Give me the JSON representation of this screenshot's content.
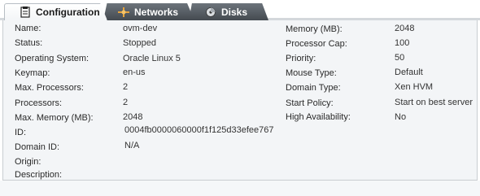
{
  "tabs": [
    {
      "label": "Configuration",
      "icon": "document-icon"
    },
    {
      "label": "Networks",
      "icon": "network-icon"
    },
    {
      "label": "Disks",
      "icon": "disk-icon"
    }
  ],
  "left_fields": [
    {
      "label": "Name:",
      "value": "ovm-dev"
    },
    {
      "label": "Status:",
      "value": "Stopped"
    },
    {
      "label": "Operating System:",
      "value": "Oracle Linux 5"
    },
    {
      "label": "Keymap:",
      "value": "en-us"
    },
    {
      "label": "Max. Processors:",
      "value": "2"
    },
    {
      "label": "Processors:",
      "value": "2"
    },
    {
      "label": "Max. Memory (MB):",
      "value": "2048"
    },
    {
      "label": "ID:",
      "value": "0004fb0000060000f1f125d33efee767"
    },
    {
      "label": "Domain ID:",
      "value": "N/A"
    },
    {
      "label": "Origin:",
      "value": ""
    },
    {
      "label": "Description:",
      "value": ""
    }
  ],
  "right_fields": [
    {
      "label": "Memory (MB):",
      "value": "2048"
    },
    {
      "label": "Processor Cap:",
      "value": "100"
    },
    {
      "label": "Priority:",
      "value": "50"
    },
    {
      "label": "Mouse Type:",
      "value": "Default"
    },
    {
      "label": "Domain Type:",
      "value": "Xen HVM"
    },
    {
      "label": "Start Policy:",
      "value": "Start on best server"
    },
    {
      "label": "High Availability:",
      "value": "No"
    }
  ],
  "colors": {
    "active_tab_bg": "#f3f5f7",
    "inactive_tab_bg": "#5a6066",
    "panel_bg": "#f3f5f7",
    "icon_accent": "#e8a33a"
  }
}
